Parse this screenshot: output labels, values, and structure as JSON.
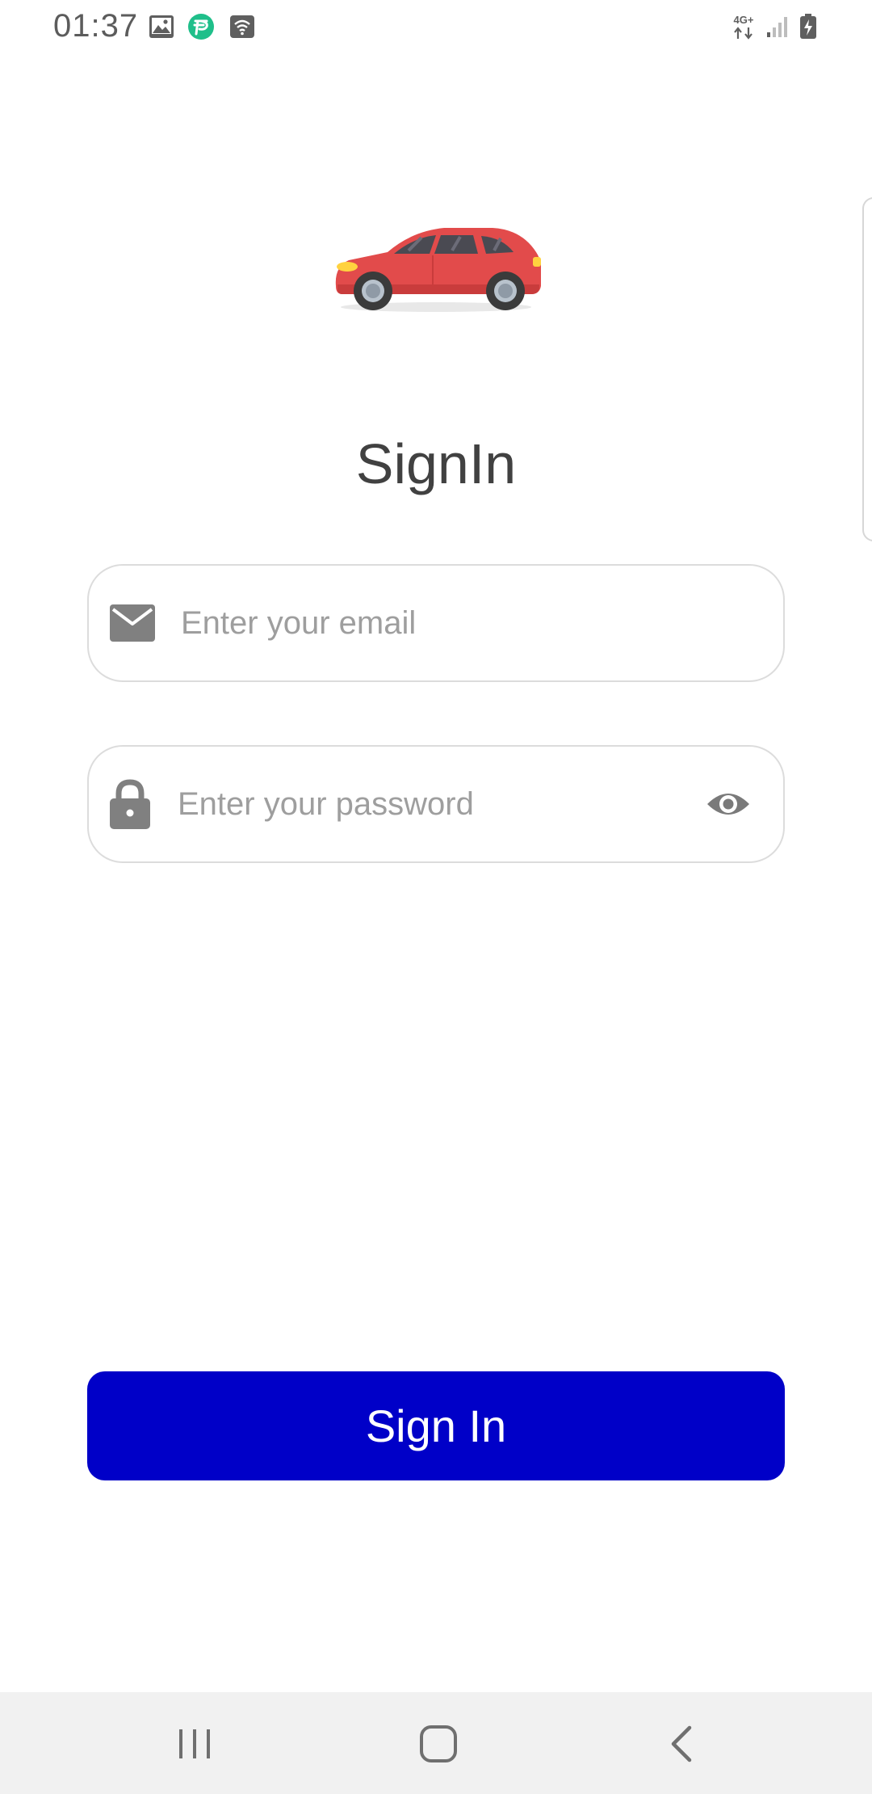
{
  "status_bar": {
    "time": "01:37",
    "network_label": "4G+",
    "icons": [
      "gallery-icon",
      "app-notification-icon",
      "wifi-calling-icon",
      "network-4g-icon",
      "signal-icon",
      "battery-charging-icon"
    ]
  },
  "logo": {
    "icon": "car-icon",
    "color": "#e24b4b"
  },
  "title": "SignIn",
  "form": {
    "email": {
      "icon": "mail-icon",
      "value": "",
      "placeholder": "Enter your email"
    },
    "password": {
      "icon": "lock-icon",
      "value": "",
      "placeholder": "Enter your password",
      "toggle_icon": "eye-icon"
    }
  },
  "signin_button": {
    "label": "Sign In",
    "color": "#0000c8"
  },
  "nav_bar": {
    "buttons": [
      "recents-icon",
      "home-icon",
      "back-icon"
    ]
  }
}
